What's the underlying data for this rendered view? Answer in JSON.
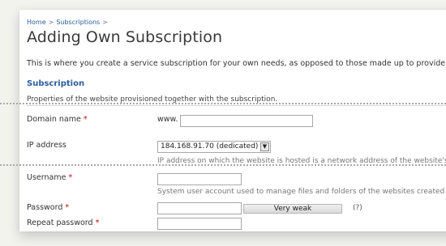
{
  "breadcrumb": {
    "items": [
      "Home",
      "Subscriptions"
    ],
    "separator": ">"
  },
  "page": {
    "title": "Adding Own Subscription",
    "intro": "This is where you create a service subscription for your own needs, as opposed to those made up to provide servi"
  },
  "section": {
    "title": "Subscription",
    "subtitle": "Properties of the website provisioned together with the subscription."
  },
  "form": {
    "domain": {
      "label": "Domain name",
      "prefix": "www.",
      "value": ""
    },
    "ip": {
      "label": "IP address",
      "selected": "184.168.91.70 (dedicated)",
      "hint": "IP address on which the website is hosted is a network address of the website's"
    },
    "username": {
      "label": "Username",
      "value": "",
      "hint": "System user account used to manage files and folders of the websites created w"
    },
    "password": {
      "label": "Password",
      "value": "",
      "strength": "Very weak",
      "help": "(?)"
    },
    "repeat_password": {
      "label": "Repeat password",
      "value": ""
    },
    "required_mark": "*"
  },
  "colors": {
    "link": "#2a5d9a",
    "required": "#cc0000",
    "page_bg": "#f3f3ee"
  },
  "icons": {
    "select_arrow": "chevron-down-icon"
  }
}
